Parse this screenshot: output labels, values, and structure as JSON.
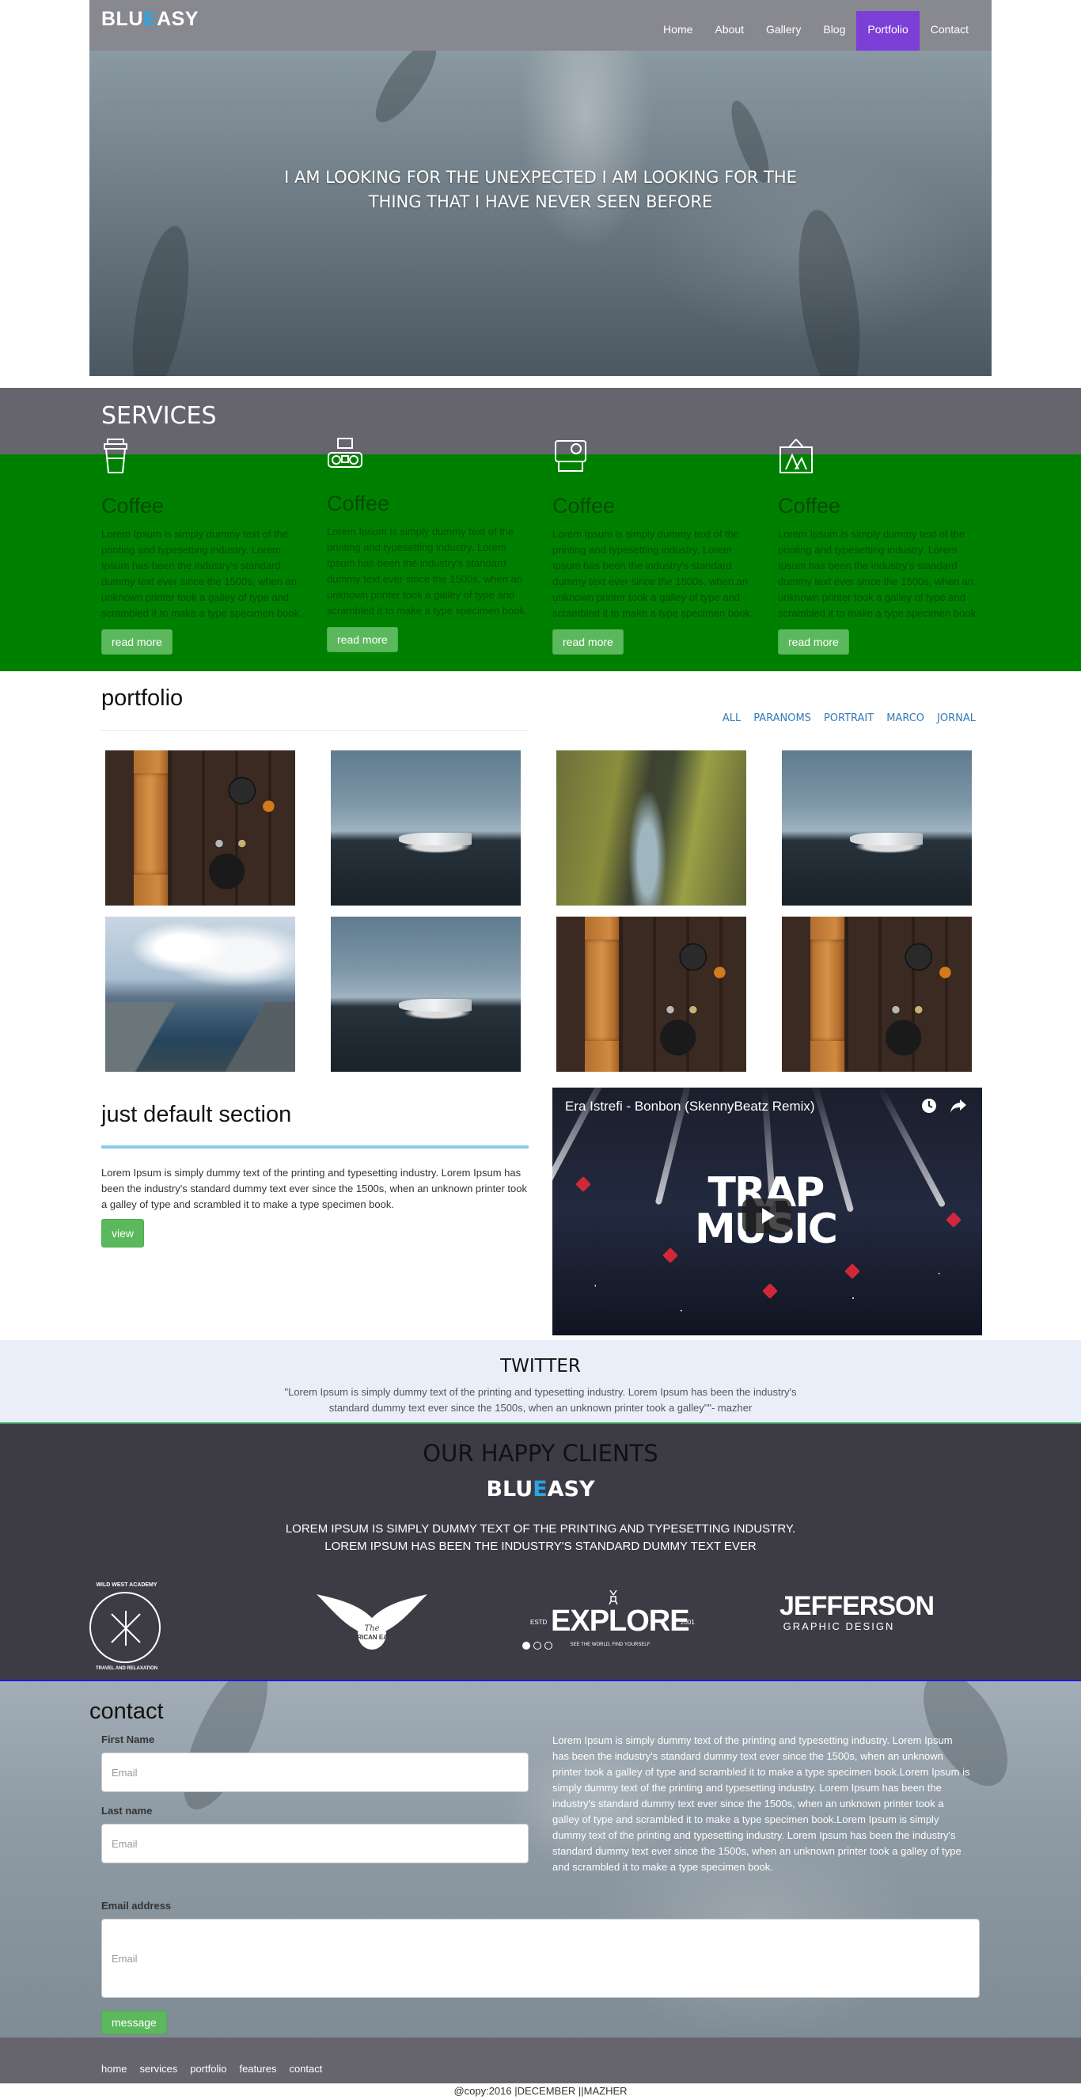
{
  "header": {
    "logo_a": "BLU",
    "logo_e": "E",
    "logo_b": "ASY",
    "nav": [
      "Home",
      "About",
      "Gallery",
      "Blog",
      "Portfolio",
      "Contact"
    ],
    "active_nav": "Portfolio",
    "accent_color": "#7b3fd6"
  },
  "hero": {
    "line1": "I AM LOOKING FOR THE UNEXPECTED I AM LOOKING FOR THE",
    "line2": "THING THAT I HAVE NEVER SEEN BEFORE"
  },
  "services": {
    "title": "SERVICES",
    "items": [
      {
        "icon": "coffee-cup-icon",
        "title": "Coffee",
        "text": "Lorem Ipsum is simply dummy text of the printing and typesetting industry. Lorem Ipsum has been the industry's standard dummy text ever since the 1500s, when an unknown printer took a galley of type and scrambled it to make a type specimen book.",
        "button": "read more"
      },
      {
        "icon": "camera-icon",
        "title": "Coffee",
        "text": "Lorem Ipsum is simply dummy text of the printing and typesetting industry. Lorem Ipsum has been the industry's standard dummy text ever since the 1500s, when an unknown printer took a galley of type and scrambled it to make a type specimen book.",
        "button": "read more"
      },
      {
        "icon": "polaroid-camera-icon",
        "title": "Coffee",
        "text": "Lorem Ipsum is simply dummy text of the printing and typesetting industry. Lorem Ipsum has been the industry's standard dummy text ever since the 1500s, when an unknown printer took a galley of type and scrambled it to make a type specimen book.",
        "button": "read more"
      },
      {
        "icon": "picture-frame-icon",
        "title": "Coffee",
        "text": "Lorem Ipsum is simply dummy text of the printing and typesetting industry. Lorem Ipsum has been the industry's standard dummy text ever since the 1500s, when an unknown printer took a galley of type and scrambled it to make a type specimen book.",
        "button": "read more"
      }
    ]
  },
  "portfolio": {
    "title": "portfolio",
    "filters": [
      "ALL",
      "PARANOMS",
      "PORTRAIT",
      "MARCO",
      "JORNAL"
    ]
  },
  "default_section": {
    "title": "just default section",
    "text": "Lorem Ipsum is simply dummy text of the printing and typesetting industry. Lorem Ipsum has been the industry's standard dummy text ever since the 1500s, when an unknown printer took a galley of type and scrambled it to make a type specimen book.",
    "button": "view"
  },
  "video": {
    "title": "Era Istrefi - Bonbon (SkennyBeatz Remix)",
    "logo_line1": "TRAP",
    "logo_line2": "MUSIC"
  },
  "twitter": {
    "title": "TWITTER",
    "quote_line1": "\"Lorem Ipsum is simply dummy text of the printing and typesetting industry. Lorem Ipsum has been the industry's",
    "quote_line2": "standard dummy text ever since the 1500s, when an unknown printer took a galley\"\"- mazher"
  },
  "clients": {
    "title": "OUR HAPPY CLIENTS",
    "logo_a": "BLU",
    "logo_e": "E",
    "logo_b": "ASY",
    "line1": "LOREM IPSUM IS SIMPLY DUMMY TEXT OF THE PRINTING AND TYPESETTING INDUSTRY.",
    "line2": "LOREM IPSUM HAS BEEN THE INDUSTRY'S STANDARD DUMMY TEXT EVER",
    "brands": {
      "wildwest": "WILD WEST ACADEMY",
      "wildwest_sub": "TRAVEL AND RELAXATION",
      "eagle_the": "The",
      "eagle_name": "AMERICAN EAGLE",
      "explore_estd": "ESTD",
      "explore": "EXPLORE",
      "explore_year": "2001",
      "explore_sub": "SEE THE WORLD, FIND YOURSELF",
      "jefferson": "JEFFERSON",
      "jefferson_sub": "GRAPHIC DESIGN"
    }
  },
  "contact": {
    "title": "contact",
    "first_name_label": "First Name",
    "last_name_label": "Last name",
    "email_label": "Email address",
    "placeholder": "Email",
    "button": "message",
    "text": "Lorem Ipsum is simply dummy text of the printing and typesetting industry. Lorem Ipsum has been the industry's standard dummy text ever since the 1500s, when an unknown printer took a galley of type and scrambled it to make a type specimen book.Lorem Ipsum is simply dummy text of the printing and typesetting industry. Lorem Ipsum has been the industry's standard dummy text ever since the 1500s, when an unknown printer took a galley of type and scrambled it to make a type specimen book.Lorem Ipsum is simply dummy text of the printing and typesetting industry. Lorem Ipsum has been the industry's standard dummy text ever since the 1500s, when an unknown printer took a galley of type and scrambled it to make a type specimen book."
  },
  "footer": {
    "nav": [
      "home",
      "services",
      "portfolio",
      "features",
      "contact"
    ],
    "copyright": "@copy:2016 |DECEMBER ||MAZHER"
  }
}
